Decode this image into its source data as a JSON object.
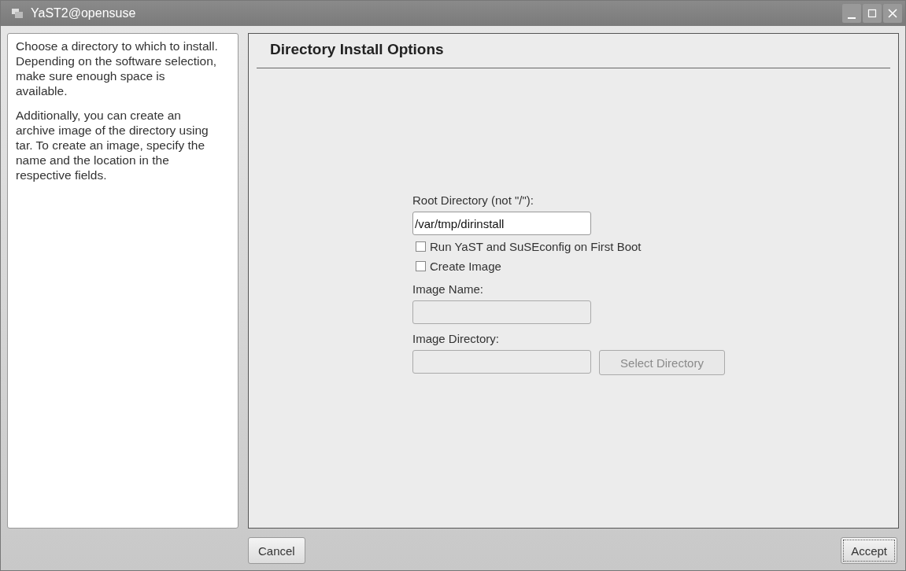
{
  "window": {
    "title": "YaST2@opensuse"
  },
  "help": {
    "paragraphs": [
      "Choose a directory to which to install. Depending on the software selection, make sure enough space is available.",
      "Additionally, you can create an archive image of the directory using tar. To create an image, specify the name and the location in the respective fields."
    ]
  },
  "panel": {
    "title": "Directory Install Options"
  },
  "form": {
    "root_label": "Root Directory (not \"/\"):",
    "root_value": "/var/tmp/dirinstall",
    "checkboxes": [
      {
        "label": "Run YaST and SuSEconfig on First Boot",
        "checked": false
      },
      {
        "label": "Create Image",
        "checked": false
      }
    ],
    "image_name_label": "Image Name:",
    "image_name_disabled": true,
    "image_dir_label": "Image Directory:",
    "image_dir_disabled": true,
    "select_button": {
      "label": "Select Directory",
      "disabled": true
    }
  },
  "buttons": {
    "cancel": "Cancel",
    "accept": "Accept"
  }
}
